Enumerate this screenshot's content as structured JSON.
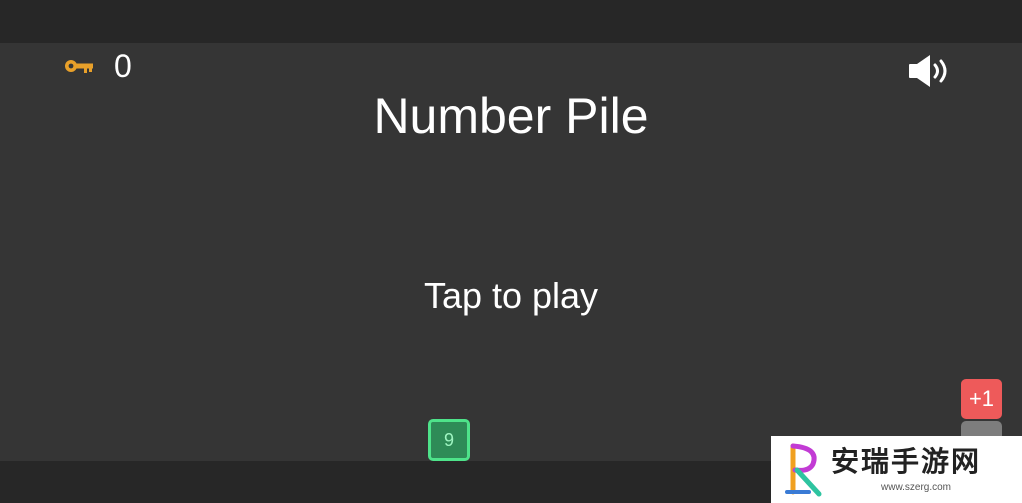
{
  "hud": {
    "keys_icon": "key-icon",
    "keys_count": "0",
    "sound_icon": "speaker-on-icon"
  },
  "game": {
    "title": "Number Pile",
    "prompt": "Tap to play",
    "current_block": "9",
    "bonus_block": "+1"
  },
  "colors": {
    "background": "#353535",
    "bars": "#272727",
    "key": "#e8a02a",
    "current_block_fill": "#2e8b57",
    "current_block_border": "#4ee38a",
    "bonus_block": "#ee5a5a",
    "stack_block": "#7d7d7d"
  },
  "watermark": {
    "name": "安瑞手游网",
    "url": "www.szerg.com"
  }
}
